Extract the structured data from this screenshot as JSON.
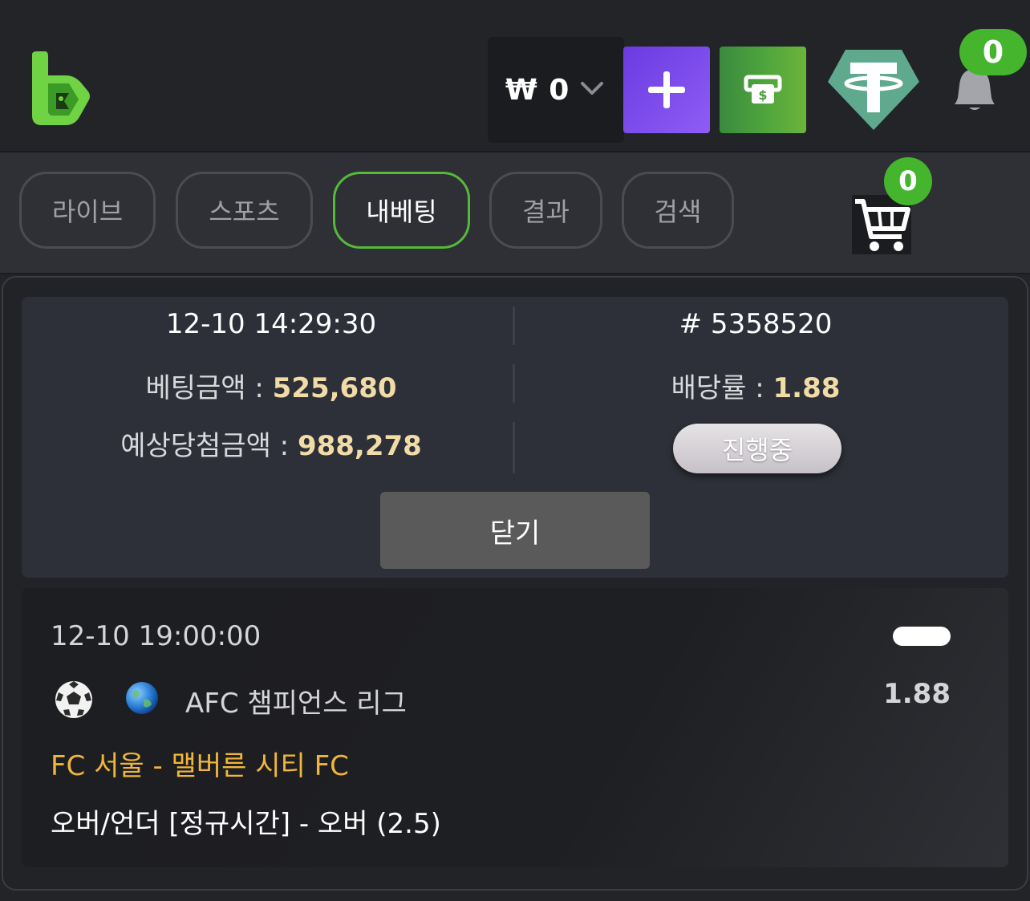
{
  "header": {
    "wallet_amount": "₩ 0",
    "bell_badge": "0",
    "icons": [
      "bc-logo-icon",
      "chevron-down-icon",
      "plus-icon",
      "cash-register-icon",
      "tether-icon",
      "bell-icon"
    ]
  },
  "tabs": [
    {
      "label": "라이브",
      "active": false
    },
    {
      "label": "스포츠",
      "active": false
    },
    {
      "label": "내베팅",
      "active": true
    },
    {
      "label": "결과",
      "active": false
    },
    {
      "label": "검색",
      "active": false
    }
  ],
  "cart": {
    "badge": "0"
  },
  "bet_summary": {
    "datetime": "12-10 14:29:30",
    "ticket": "# 5358520",
    "stake_label": "베팅금액 : ",
    "stake_value": "525,680",
    "odds_label": "배당률 : ",
    "odds_value": "1.88",
    "payout_label": "예상당첨금액 : ",
    "payout_value": "988,278",
    "status": "진행중",
    "close_label": "닫기"
  },
  "bet_detail": {
    "datetime": "12-10 19:00:00",
    "league": "AFC 챔피언스 리그",
    "odds": "1.88",
    "match": "FC 서울 - 맬버른 시티 FC",
    "market": "오버/언더 [정규시간] - 오버 (2.5)"
  },
  "colors": {
    "accent_green": "#46b52e",
    "highlight_gold": "#f1dba6",
    "match_orange": "#f0b63c",
    "purple": "#7b4bec"
  }
}
